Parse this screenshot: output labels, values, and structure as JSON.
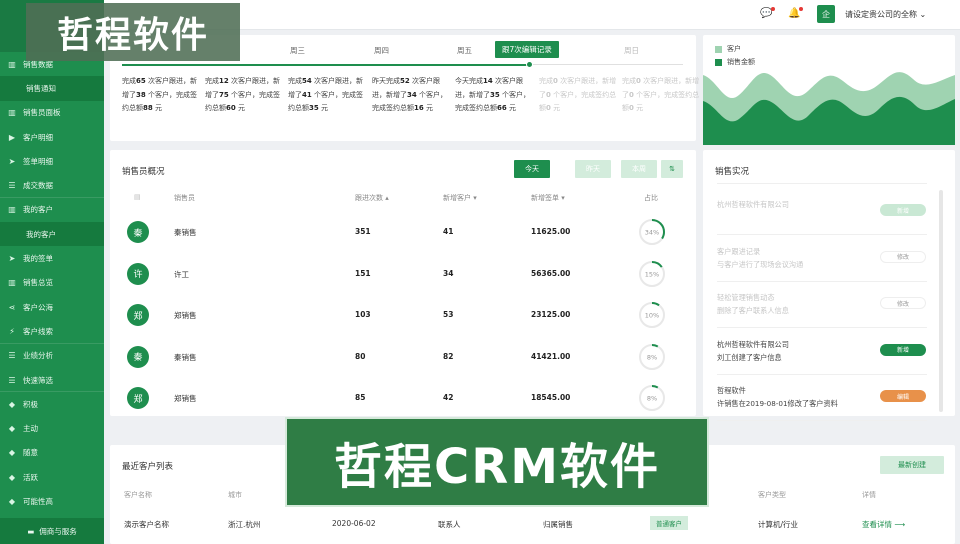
{
  "sidebar": {
    "items": [
      {
        "icon": "bars-icon",
        "label": "销售数据"
      },
      {
        "icon": "",
        "label": "销售通知",
        "sub": true
      },
      {
        "icon": "bars-icon",
        "label": "销售员面板"
      },
      {
        "icon": "video-icon",
        "label": "客户明细"
      },
      {
        "icon": "send-icon",
        "label": "签单明细"
      },
      {
        "icon": "list-icon",
        "label": "成交数据"
      },
      {
        "icon": "bars-icon",
        "label": "我的客户"
      },
      {
        "icon": "",
        "label": "我的客户",
        "sub": true
      },
      {
        "icon": "send-icon",
        "label": "我的签单"
      },
      {
        "icon": "bars-icon",
        "label": "销售总览"
      },
      {
        "icon": "share-icon",
        "label": "客户公海"
      },
      {
        "icon": "bolt-icon",
        "label": "客户线索"
      },
      {
        "icon": "list-icon",
        "label": "业绩分析"
      },
      {
        "icon": "list-icon",
        "label": "快速筛选"
      },
      {
        "icon": "tag-icon",
        "label": "积极"
      },
      {
        "icon": "tag-icon",
        "label": "主动"
      },
      {
        "icon": "tag-icon",
        "label": "随意"
      },
      {
        "icon": "tag-icon",
        "label": "活跃"
      },
      {
        "icon": "tag-icon",
        "label": "可能性高"
      }
    ],
    "bottom_label": "佣商与服务"
  },
  "header": {
    "company": "请设定贵公司的全称",
    "company_badge": "企"
  },
  "week": {
    "days": [
      "周三",
      "周四",
      "周五",
      "跟7次编辑记录",
      "周日"
    ],
    "stats": [
      {
        "a": "完成",
        "n1": "65",
        "b": "次客户跟进，新增了",
        "n2": "38",
        "c": "个客户，完成签约总额",
        "n3": "88",
        "d": "元",
        "dim": false
      },
      {
        "a": "完成",
        "n1": "12",
        "b": "次客户跟进，新增了",
        "n2": "75",
        "c": "个客户，完成签约总额",
        "n3": "60",
        "d": "元",
        "dim": false
      },
      {
        "a": "完成",
        "n1": "54",
        "b": "次客户跟进，新增了",
        "n2": "41",
        "c": "个客户，完成签约总额",
        "n3": "35",
        "d": "元",
        "dim": false
      },
      {
        "a": "昨天完成",
        "n1": "52",
        "b": "次客户跟进，新增了",
        "n2": "34",
        "c": "个客户，完成签约总额",
        "n3": "16",
        "d": "元",
        "dim": false
      },
      {
        "a": "今天完成",
        "n1": "14",
        "b": "次客户跟进，新增了",
        "n2": "35",
        "c": "个客户，完成签约总额",
        "n3": "66",
        "d": "元",
        "dim": false
      },
      {
        "a": "完成",
        "n1": "0",
        "b": "次客户跟进，新增了",
        "n2": "0",
        "c": "个客户，完成签约总额",
        "n3": "0",
        "d": "元",
        "dim": true
      },
      {
        "a": "完成",
        "n1": "0",
        "b": "次客户跟进，新增了",
        "n2": "0",
        "c": "个客户，完成签约总额",
        "n3": "0",
        "d": "元",
        "dim": true
      }
    ]
  },
  "area_chart": {
    "legend": [
      "客户",
      "销售金额"
    ],
    "colors": [
      "#9fd3b1",
      "#1e8e4e"
    ]
  },
  "sales": {
    "title": "销售员概况",
    "filters": [
      "今天",
      "昨天",
      "本周"
    ],
    "headers": [
      "销售员",
      "跟进次数 ▴",
      "新增客户 ▾",
      "新增签单 ▾",
      "占比"
    ],
    "rows": [
      {
        "avatar": "秦",
        "name": "秦销售",
        "follow": "351",
        "new_customers": "41",
        "new_orders": "11625.00",
        "share": "34%",
        "share_pct": 34
      },
      {
        "avatar": "许",
        "name": "许工",
        "follow": "151",
        "new_customers": "34",
        "new_orders": "56365.00",
        "share": "15%",
        "share_pct": 15
      },
      {
        "avatar": "郑",
        "name": "郑销售",
        "follow": "103",
        "new_customers": "53",
        "new_orders": "23125.00",
        "share": "10%",
        "share_pct": 10
      },
      {
        "avatar": "秦",
        "name": "秦销售",
        "follow": "80",
        "new_customers": "82",
        "new_orders": "41421.00",
        "share": "8%",
        "share_pct": 8
      },
      {
        "avatar": "郑",
        "name": "郑销售",
        "follow": "85",
        "new_customers": "42",
        "new_orders": "18545.00",
        "share": "8%",
        "share_pct": 8
      }
    ]
  },
  "progress": {
    "title": "销售实况",
    "items": [
      {
        "title": "杭州哲程软件有限公司",
        "desc": "",
        "btn": "新增",
        "btn_color": "#c9e8d4",
        "faded": true
      },
      {
        "title": "客户跟进记录",
        "desc": "与客户进行了现场会议沟通",
        "btn": "修改",
        "btn_color": "#ffffff",
        "faded": true
      },
      {
        "title": "轻松管理销售动态",
        "desc": "删除了客户联系人信息",
        "btn": "修改",
        "btn_color": "#ffffff",
        "faded": true
      },
      {
        "title": "杭州哲程软件有限公司",
        "desc": "刘工创建了客户信息",
        "btn": "新增",
        "btn_color": "#1e8e4e",
        "faded": false
      },
      {
        "title": "哲程软件",
        "desc": "许销售在2019-08-01修改了客户资料",
        "btn": "编辑",
        "btn_color": "#e8914a",
        "faded": false
      }
    ]
  },
  "recent": {
    "title": "最近客户列表",
    "new_button": "最新创建",
    "headers": [
      "客户名称",
      "城市",
      "客户类型",
      "详情"
    ],
    "row": {
      "name": "演示客户名称",
      "city": "浙江.杭州",
      "date": "2020-06-02",
      "contact": "联系人",
      "owner": "归属销售",
      "tag": "普通客户",
      "type": "计算机/行业",
      "detail": "查看详情 ⟶"
    }
  },
  "watermarks": {
    "top": "哲程软件",
    "bottom": "哲程CRM软件"
  }
}
